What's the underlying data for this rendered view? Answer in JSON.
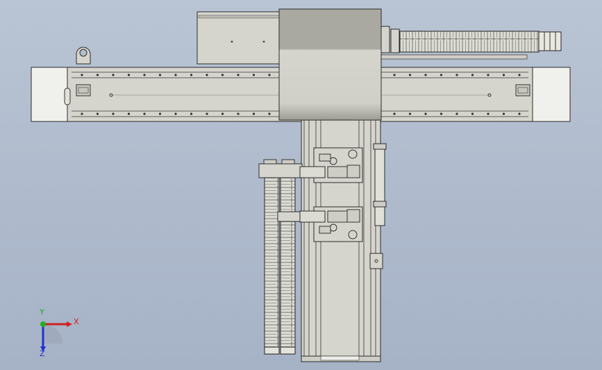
{
  "viewport": {
    "background_top": "#b9c4d4",
    "background_bottom": "#a6b2c6",
    "model_fill": "#d6d5cd",
    "model_stroke": "#2a2a2a",
    "carriage_top": "#a8a8a0",
    "carriage_body": "#d2d2ca"
  },
  "triad": {
    "x_label": "X",
    "y_label": "Y",
    "z_label": "Z",
    "x_color": "#d02020",
    "y_color": "#20b020",
    "z_color": "#2030d0"
  }
}
